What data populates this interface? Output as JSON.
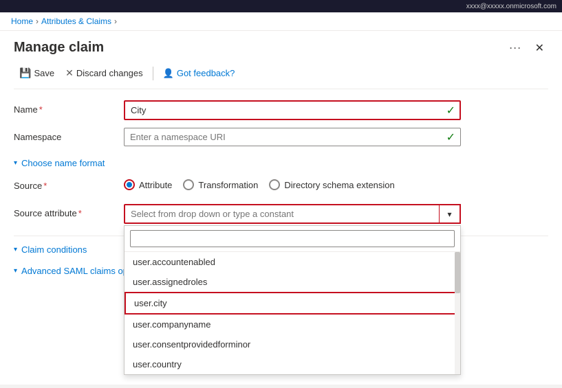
{
  "topbar": {
    "text": "xxxx@xxxxx.onmicrosoft.com"
  },
  "breadcrumb": {
    "home": "Home",
    "attributes_claims": "Attributes & Claims",
    "separator": "›"
  },
  "panel": {
    "title": "Manage claim",
    "ellipsis": "···",
    "close": "✕"
  },
  "toolbar": {
    "save": "Save",
    "discard": "Discard changes",
    "feedback": "Got feedback?"
  },
  "form": {
    "name_label": "Name",
    "name_required": "*",
    "name_value": "City",
    "namespace_label": "Namespace",
    "namespace_placeholder": "Enter a namespace URI",
    "choose_name_format": "Choose name format",
    "source_label": "Source",
    "source_required": "*",
    "source_options": [
      {
        "id": "attribute",
        "label": "Attribute",
        "selected": true
      },
      {
        "id": "transformation",
        "label": "Transformation",
        "selected": false
      },
      {
        "id": "directory",
        "label": "Directory schema extension",
        "selected": false
      }
    ],
    "source_attribute_label": "Source attribute",
    "source_attribute_required": "*",
    "source_attribute_placeholder": "Select from drop down or type a constant",
    "claim_conditions": "Claim conditions",
    "advanced_saml": "Advanced SAML claims options"
  },
  "dropdown": {
    "search_placeholder": "",
    "items": [
      {
        "value": "user.accountenabled",
        "selected": false
      },
      {
        "value": "user.assignedroles",
        "selected": false
      },
      {
        "value": "user.city",
        "selected": true
      },
      {
        "value": "user.companyname",
        "selected": false
      },
      {
        "value": "user.consentprovidedforminor",
        "selected": false
      },
      {
        "value": "user.country",
        "selected": false
      }
    ]
  }
}
